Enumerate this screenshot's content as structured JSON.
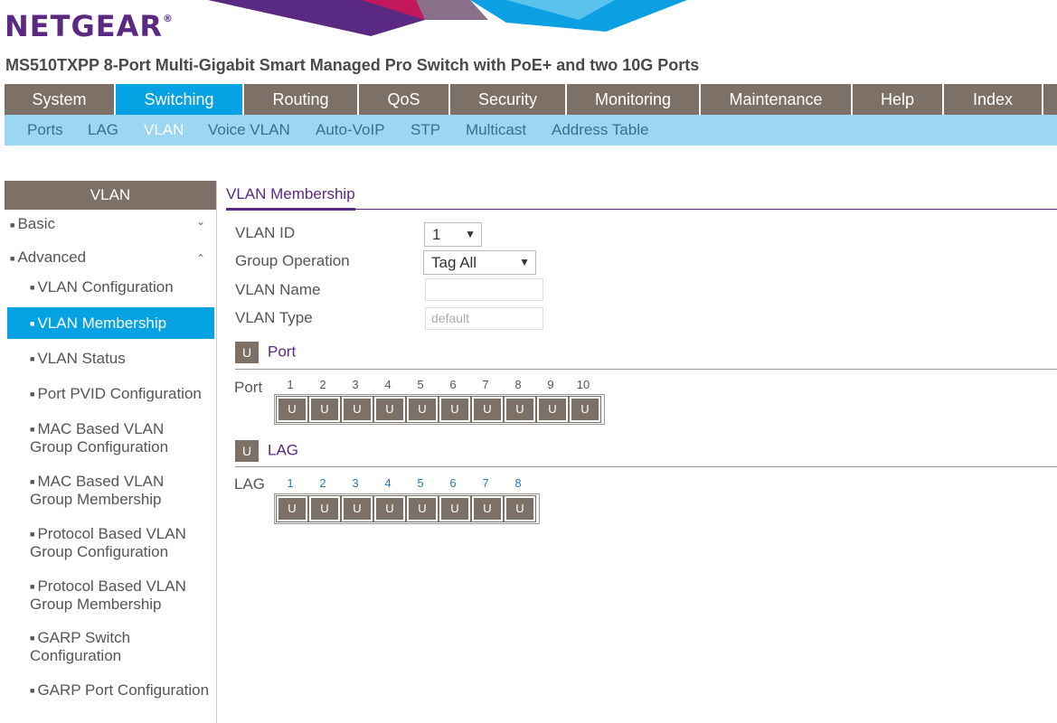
{
  "brand": {
    "name": "NETGEAR",
    "mark": "®"
  },
  "product_title": "MS510TXPP 8-Port Multi-Gigabit Smart Managed Pro Switch with PoE+ and two 10G Ports",
  "top_nav": [
    "System",
    "Switching",
    "Routing",
    "QoS",
    "Security",
    "Monitoring",
    "Maintenance",
    "Help",
    "Index"
  ],
  "top_nav_active": "Switching",
  "sub_nav": [
    "Ports",
    "LAG",
    "VLAN",
    "Voice VLAN",
    "Auto-VoIP",
    "STP",
    "Multicast",
    "Address Table"
  ],
  "sub_nav_active": "VLAN",
  "sidebar": {
    "title": "VLAN",
    "groups": [
      {
        "label": "Basic",
        "state": "collapsed"
      },
      {
        "label": "Advanced",
        "state": "expanded"
      }
    ],
    "items": [
      "VLAN Configuration",
      "VLAN Membership",
      "VLAN Status",
      "Port PVID Configuration",
      "MAC Based VLAN Group Configuration",
      "MAC Based VLAN Group Membership",
      "Protocol Based VLAN Group Configuration",
      "Protocol Based VLAN Group Membership",
      "GARP Switch Configuration",
      "GARP Port Configuration"
    ],
    "active_item": "VLAN Membership"
  },
  "content": {
    "title": "VLAN Membership",
    "fields": {
      "vlan_id": {
        "label": "VLAN ID",
        "value": "1"
      },
      "group_operation": {
        "label": "Group Operation",
        "value": "Tag All"
      },
      "vlan_name": {
        "label": "VLAN Name",
        "value": ""
      },
      "vlan_type": {
        "label": "VLAN Type",
        "value": "default"
      }
    },
    "port_section": {
      "icon_text": "U",
      "title": "Port",
      "row_label": "Port",
      "numbers": [
        "1",
        "2",
        "3",
        "4",
        "5",
        "6",
        "7",
        "8",
        "9",
        "10"
      ],
      "states": [
        "U",
        "U",
        "U",
        "U",
        "U",
        "U",
        "U",
        "U",
        "U",
        "U"
      ]
    },
    "lag_section": {
      "icon_text": "U",
      "title": "LAG",
      "row_label": "LAG",
      "numbers": [
        "1",
        "2",
        "3",
        "4",
        "5",
        "6",
        "7",
        "8"
      ],
      "states": [
        "U",
        "U",
        "U",
        "U",
        "U",
        "U",
        "U",
        "U"
      ]
    }
  },
  "colors": {
    "brand_purple": "#5a2a82",
    "nav_gray": "#7d7167",
    "accent_blue": "#05a2e3",
    "subnav_blue": "#9bd6f3"
  }
}
